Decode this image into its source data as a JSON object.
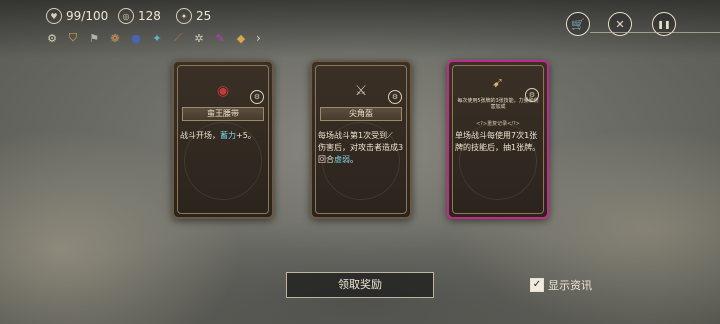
{
  "hud": {
    "hp": "99/100",
    "gold": "128",
    "ember": "25"
  },
  "relics": [
    {
      "icon": "gear-relic-icon",
      "glyph": "⚙",
      "color": "#d9cfb8"
    },
    {
      "icon": "shield-relic-icon",
      "glyph": "⛉",
      "color": "#e0b13a"
    },
    {
      "icon": "flag-relic-icon",
      "glyph": "⚑",
      "color": "#b7b0a8"
    },
    {
      "icon": "scroll-relic-icon",
      "glyph": "❁",
      "color": "#c9935c"
    },
    {
      "icon": "orb-relic-icon",
      "glyph": "●",
      "color": "#4a62b8"
    },
    {
      "icon": "bird-relic-icon",
      "glyph": "✦",
      "color": "#5fb7c9"
    },
    {
      "icon": "blade-relic-icon",
      "glyph": "⟋",
      "color": "#a8774a"
    },
    {
      "icon": "cog-relic-icon",
      "glyph": "✲",
      "color": "#d1c6ae"
    },
    {
      "icon": "wand-relic-icon",
      "glyph": "✎",
      "color": "#b33fb8"
    },
    {
      "icon": "bag-relic-icon",
      "glyph": "◆",
      "color": "#d9a64b"
    }
  ],
  "cards": [
    {
      "name": "蛮王腰带",
      "desc_pre": "战斗开场，",
      "keyword": "蓄力",
      "desc_post": "+5。",
      "art_glyph": "◉",
      "art_color": "#c23a3a"
    },
    {
      "name": "尖角盔",
      "desc_pre": "每场战斗第1次受到",
      "desc_mid": "伤害后，对攻击者造成3回合",
      "keyword": "虚弱",
      "desc_post": "。",
      "art_glyph": "⚔",
      "art_color": "#c9c2b0"
    },
    {
      "name_small": "每次使用5张牌的3张技能，力量和伤害加成",
      "sub_small": "<?>重复记录</?>",
      "desc": "单场战斗每使用7次1张牌的技能后，抽1张牌。",
      "art_glyph": "➹",
      "art_color": "#d8b070"
    }
  ],
  "claim_label": "领取奖励",
  "show_info_label": "显示资讯",
  "show_info_checked": "✓",
  "topbar": {
    "shop_glyph": "🛒",
    "map_glyph": "✕",
    "pause_glyph": "❚❚"
  }
}
